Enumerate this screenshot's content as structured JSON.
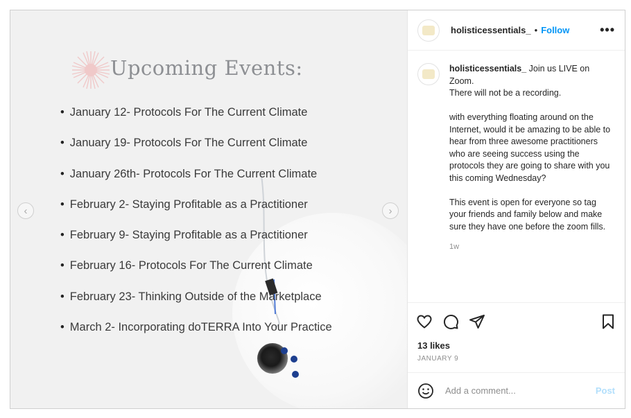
{
  "media": {
    "title": "Upcoming Events:",
    "events": [
      "January 12- Protocols For The Current Climate",
      "January 19- Protocols For The Current Climate",
      "January  26th- Protocols For The Current Climate",
      "February 2- Staying Profitable as a Practitioner",
      "February 9- Staying Profitable as a Practitioner",
      "February 16- Protocols For The Current Climate",
      "February 23- Thinking Outside of the Marketplace",
      "March 2- Incorporating doTERRA Into Your Practice"
    ],
    "prev_icon": "‹",
    "next_icon": "›",
    "colors": {
      "burst": "#f0c9c9",
      "dots": "#1d3f8f"
    }
  },
  "header": {
    "username": "holisticessentials_",
    "separator": "•",
    "follow_label": "Follow",
    "more_label": "•••"
  },
  "caption": {
    "username": "holisticessentials_",
    "text": " Join us LIVE on Zoom.\nThere will not be a recording.\n\nwith everything floating around on the Internet, would it be amazing to be able to hear from three awesome practitioners who are seeing success using the protocols they are going to share with you this coming Wednesday?\n\nThis event is open for everyone so tag your friends and family below and make sure they have one before the zoom fills.",
    "time_ago": "1w"
  },
  "actions": {
    "icons": [
      "heart-icon",
      "comment-icon",
      "share-icon",
      "bookmark-icon"
    ]
  },
  "likes": "13 likes",
  "date": "JANUARY 9",
  "comment": {
    "placeholder": "Add a comment...",
    "post_label": "Post"
  }
}
